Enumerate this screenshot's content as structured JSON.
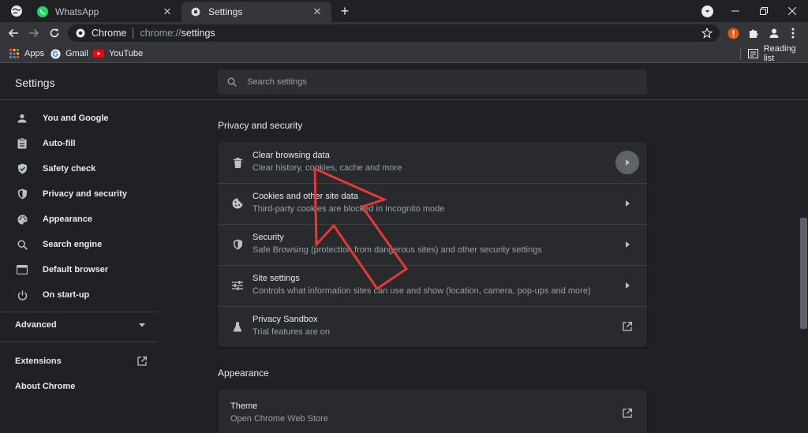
{
  "browser": {
    "tabs": [
      {
        "title": "WhatsApp",
        "active": false,
        "icon": "whatsapp-icon"
      },
      {
        "title": "Settings",
        "active": true,
        "icon": "gear-icon"
      }
    ],
    "omnibox": {
      "site_name": "Chrome",
      "url_scheme": "chrome://",
      "url_path": "settings"
    },
    "bookmarks": [
      {
        "label": "Apps",
        "icon": "apps-grid-icon"
      },
      {
        "label": "Gmail",
        "icon": "google-icon"
      },
      {
        "label": "YouTube",
        "icon": "youtube-icon"
      }
    ],
    "reading_list": "Reading list"
  },
  "settings": {
    "title": "Settings",
    "search_placeholder": "Search settings",
    "sidebar": {
      "items": [
        {
          "label": "You and Google",
          "icon": "person-icon"
        },
        {
          "label": "Auto-fill",
          "icon": "clipboard-icon"
        },
        {
          "label": "Safety check",
          "icon": "shield-check-icon"
        },
        {
          "label": "Privacy and security",
          "icon": "shield-icon"
        },
        {
          "label": "Appearance",
          "icon": "palette-icon"
        },
        {
          "label": "Search engine",
          "icon": "search-icon"
        },
        {
          "label": "Default browser",
          "icon": "browser-icon"
        },
        {
          "label": "On start-up",
          "icon": "power-icon"
        }
      ],
      "advanced": "Advanced",
      "extensions": "Extensions",
      "about": "About Chrome"
    },
    "privacy_section": {
      "title": "Privacy and security",
      "rows": [
        {
          "title": "Clear browsing data",
          "subtitle": "Clear history, cookies, cache and more",
          "icon": "trash-icon",
          "action": "arrow"
        },
        {
          "title": "Cookies and other site data",
          "subtitle": "Third-party cookies are blocked in Incognito mode",
          "icon": "cookie-icon",
          "action": "arrow"
        },
        {
          "title": "Security",
          "subtitle": "Safe Browsing (protection from dangerous sites) and other security settings",
          "icon": "shield-icon",
          "action": "arrow"
        },
        {
          "title": "Site settings",
          "subtitle": "Controls what information sites can use and show (location, camera, pop-ups and more)",
          "icon": "sliders-icon",
          "action": "arrow"
        },
        {
          "title": "Privacy Sandbox",
          "subtitle": "Trial features are on",
          "icon": "flask-icon",
          "action": "external"
        }
      ]
    },
    "appearance_section": {
      "title": "Appearance",
      "rows": [
        {
          "title": "Theme",
          "subtitle": "Open Chrome Web Store",
          "action": "external"
        }
      ]
    }
  },
  "colors": {
    "background": "#202124",
    "card": "#292a2d",
    "annotation_arrow": "#e53935"
  }
}
